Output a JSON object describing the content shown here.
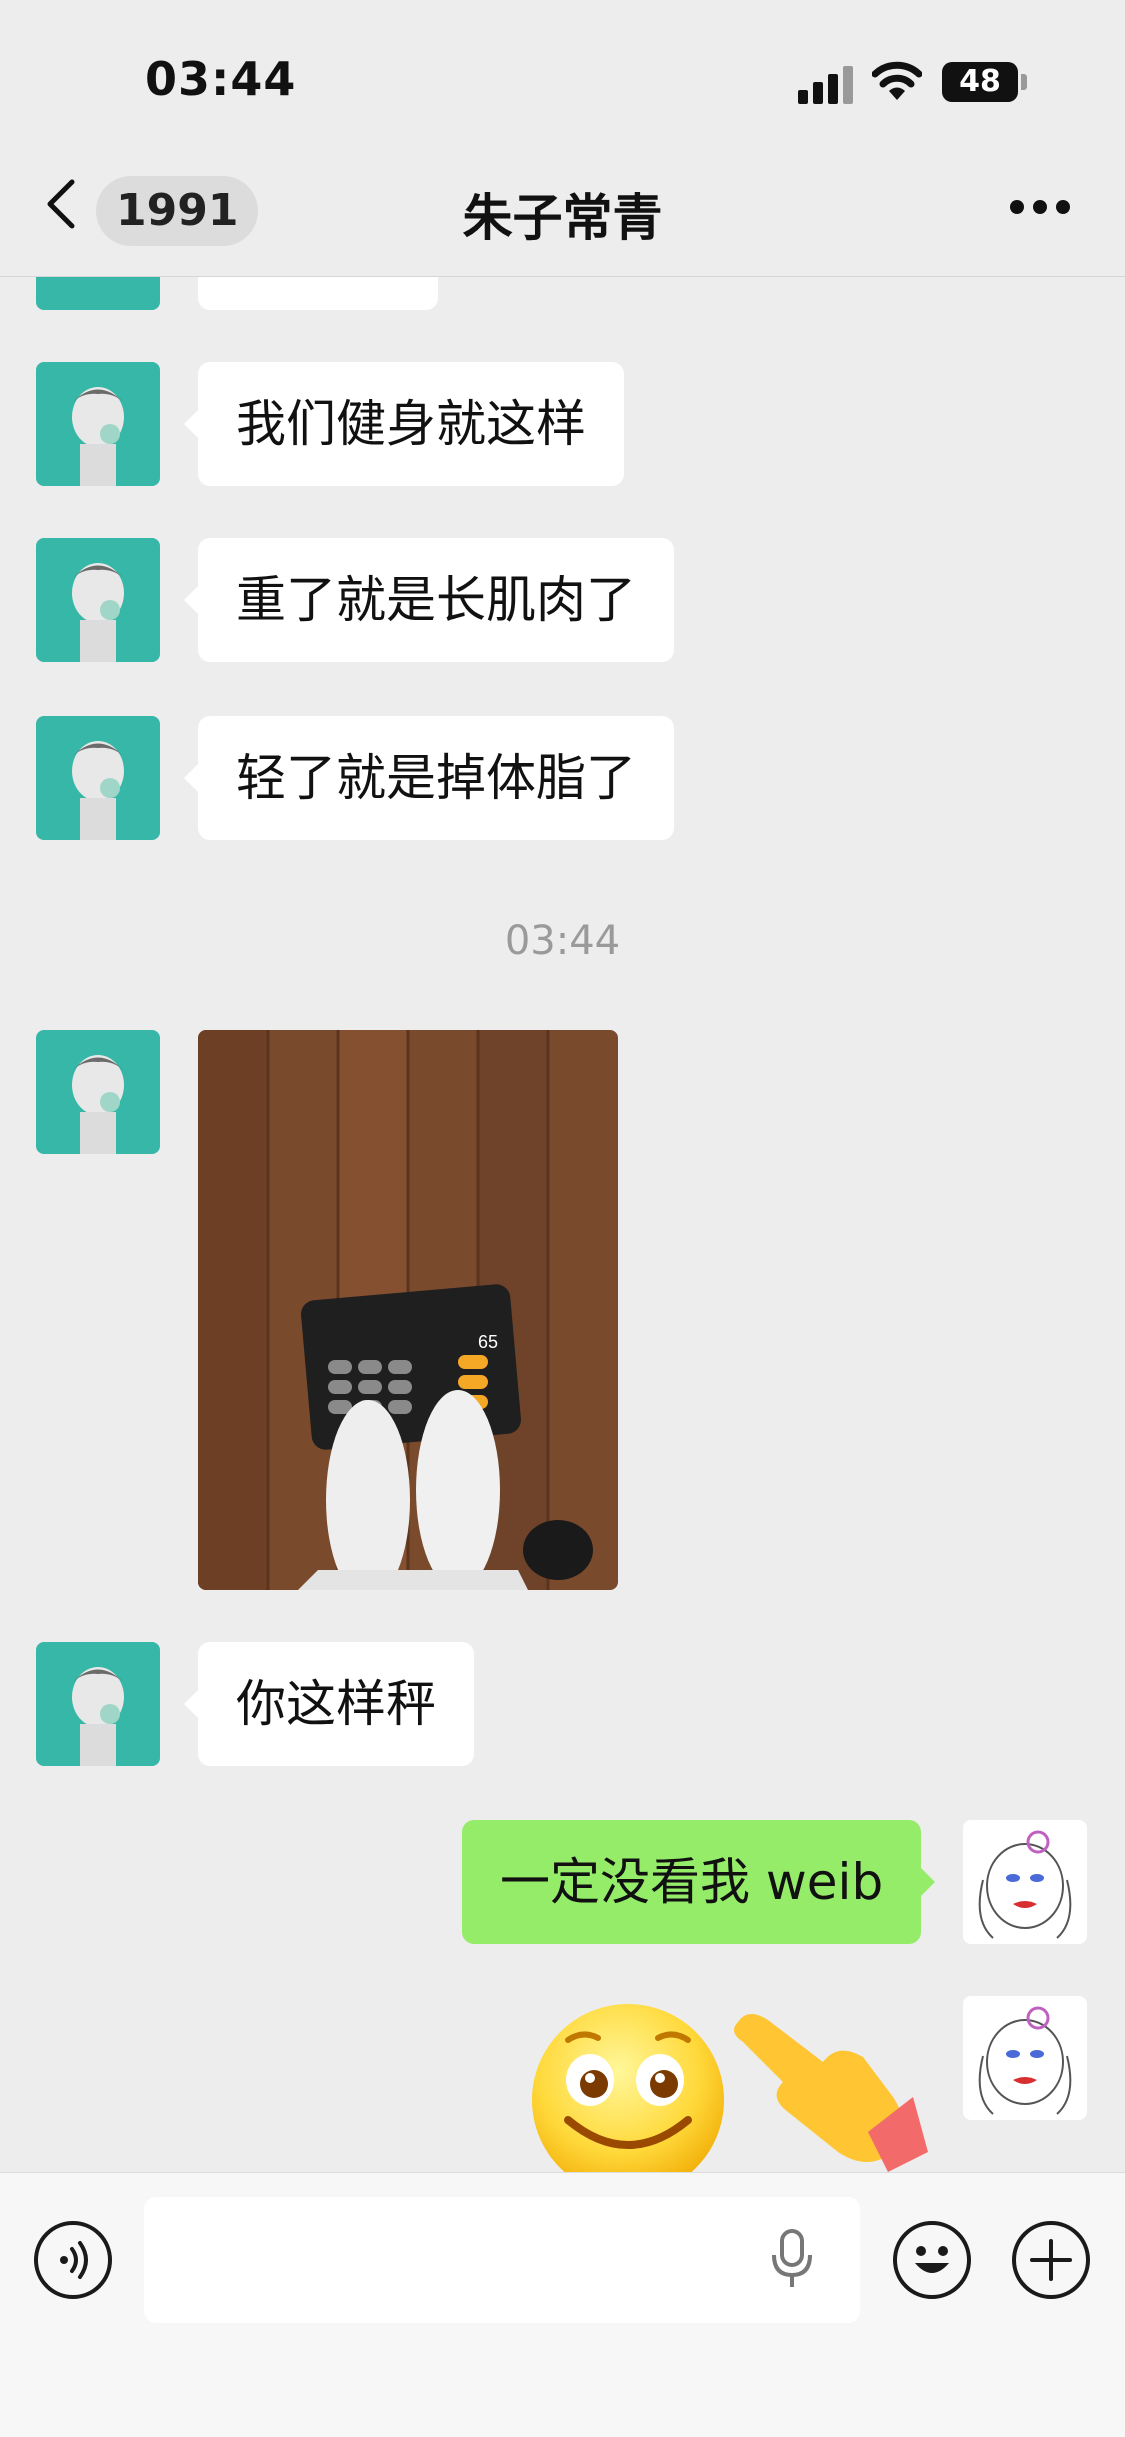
{
  "status_bar": {
    "time": "03:44",
    "battery": "48"
  },
  "nav": {
    "back_count": "1991",
    "title": "朱子常青"
  },
  "messages": [
    {
      "text": "我们健身就这样"
    },
    {
      "text": "重了就是长肌肉了"
    },
    {
      "text": "轻了就是掉体脂了"
    },
    {
      "timestamp": "03:44"
    },
    {
      "image_text": "65"
    },
    {
      "text": "你这样秤"
    },
    {
      "text": "一定没看我 weib",
      "from_me": true
    }
  ],
  "colors": {
    "me_bubble": "#95ec69",
    "other_bubble": "#ffffff",
    "background": "#ededed",
    "avatar_bg": "#36b7a8"
  },
  "icons": [
    "chevron-left-icon",
    "more-icon",
    "voice-icon",
    "microphone-icon",
    "emoji-icon",
    "plus-icon",
    "smile-emoji-icon",
    "pointing-hand-emoji-icon"
  ]
}
